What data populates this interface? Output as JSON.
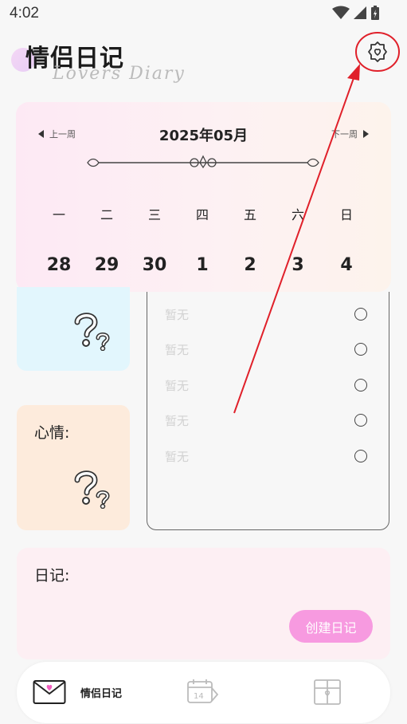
{
  "status_bar": {
    "time": "4:02"
  },
  "header": {
    "title": "情侣日记",
    "subtitle": "Lovers Diary"
  },
  "calendar": {
    "prev_label": "上一周",
    "next_label": "下一周",
    "month": "2025年05月",
    "weekdays": [
      "一",
      "二",
      "三",
      "四",
      "五",
      "六",
      "日"
    ],
    "days": [
      "28",
      "29",
      "30",
      "1",
      "2",
      "3",
      "4"
    ]
  },
  "mood": {
    "label": "心情:"
  },
  "todos": [
    {
      "text": "暂无"
    },
    {
      "text": "暂无"
    },
    {
      "text": "暂无"
    },
    {
      "text": "暂无"
    },
    {
      "text": "暂无"
    }
  ],
  "diary": {
    "label": "日记:",
    "create_button": "创建日记"
  },
  "nav": {
    "tabs": [
      {
        "label": "情侣日记"
      }
    ]
  },
  "colors": {
    "accent": "#f79ae0",
    "annotation": "#e0202a"
  }
}
